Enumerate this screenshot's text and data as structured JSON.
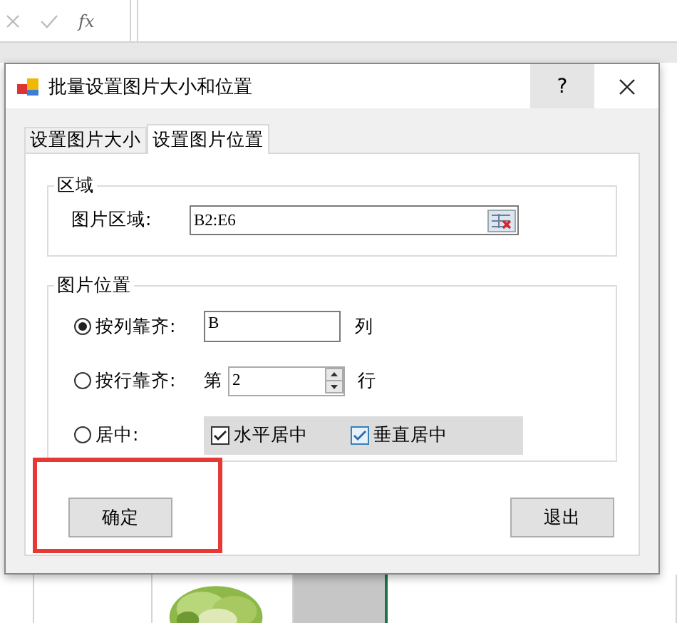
{
  "formula_bar": {
    "function_label": "fx"
  },
  "dialog": {
    "title": "批量设置图片大小和位置",
    "help": "?",
    "tabs": [
      {
        "label": "设置图片大小",
        "selected": false
      },
      {
        "label": "设置图片位置",
        "selected": true
      }
    ],
    "area_group": {
      "title": "区域",
      "label": "图片区域:",
      "value": "B2:E6"
    },
    "position_group": {
      "title": "图片位置",
      "options": [
        {
          "kind": "text",
          "label": "按列靠齐:",
          "selected": true,
          "value": "B",
          "suffix": "列"
        },
        {
          "kind": "spin",
          "label": "按行靠齐:",
          "selected": false,
          "prefix": "第",
          "value": "2",
          "suffix": "行"
        },
        {
          "kind": "checks",
          "label": "居中:",
          "selected": false,
          "checks": [
            {
              "label": "水平居中",
              "checked": true,
              "focused": false
            },
            {
              "label": "垂直居中",
              "checked": true,
              "focused": true
            }
          ]
        }
      ]
    },
    "buttons": [
      "确定",
      "退出"
    ]
  }
}
